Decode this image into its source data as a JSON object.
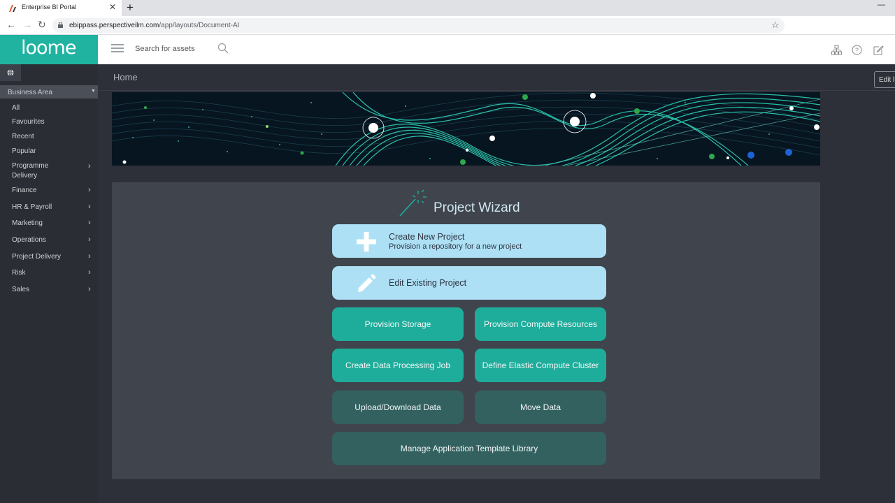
{
  "browser": {
    "tab_title": "Enterprise BI Portal",
    "tab_close": "✕",
    "new_tab": "+",
    "minimize": "—",
    "url_host": "ebippass.perspectiveilm.com",
    "url_path": "/app/layouts/Document-AI"
  },
  "header": {
    "logo": "loome",
    "search_placeholder": "Search for assets",
    "icons": [
      "sitemap-icon",
      "help-icon",
      "edit-icon"
    ]
  },
  "sidebar": {
    "business_area": "Business Area",
    "items": [
      {
        "label": "All",
        "has_children": false
      },
      {
        "label": "Favourites",
        "has_children": false
      },
      {
        "label": "Recent",
        "has_children": false
      },
      {
        "label": "Popular",
        "has_children": false
      },
      {
        "label": "Programme",
        "label2": "Delivery",
        "has_children": true
      },
      {
        "label": "Finance",
        "has_children": true
      },
      {
        "label": "HR & Payroll",
        "has_children": true
      },
      {
        "label": "Marketing",
        "has_children": true
      },
      {
        "label": "Operations",
        "has_children": true
      },
      {
        "label": "Project Delivery",
        "has_children": true
      },
      {
        "label": "Risk",
        "has_children": true
      },
      {
        "label": "Sales",
        "has_children": true
      }
    ]
  },
  "main": {
    "breadcrumb": "Home",
    "edit_label": "Edit l",
    "wizard": {
      "title": "Project Wizard",
      "create_title": "Create New Project",
      "create_sub": "Provision a repository for a new project",
      "edit_title": "Edit Existing Project",
      "provision_storage": "Provision Storage",
      "provision_compute": "Provision Compute Resources",
      "create_job": "Create Data Processing Job",
      "define_cluster": "Define Elastic Compute Cluster",
      "upload_download": "Upload/Download Data",
      "move_data": "Move Data",
      "manage_library": "Manage Application Template Library"
    }
  },
  "colors": {
    "brand_teal": "#1fb3a0",
    "button_light": "#ade0f5",
    "button_teal": "#1fad9b",
    "button_dark": "#326160",
    "sidebar_bg": "#2a2d34",
    "panel_bg": "#40444c"
  }
}
